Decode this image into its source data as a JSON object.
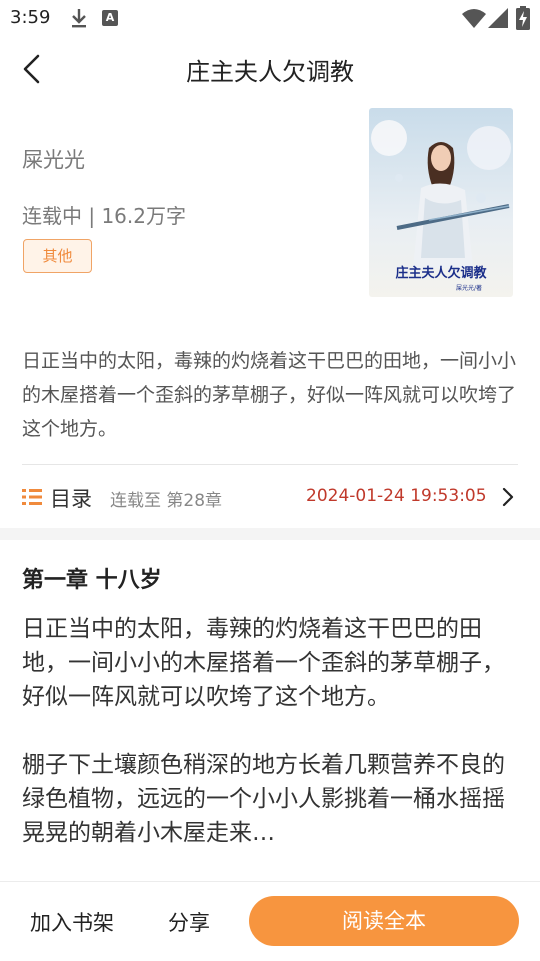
{
  "status_bar": {
    "time": "3:59",
    "a_icon_glyph": "A"
  },
  "header": {
    "title": "庄主夫人欠调教"
  },
  "book": {
    "author": "屎光光",
    "status": "连载中 | 16.2万字",
    "tag": "其他",
    "cover_title": "庄主夫人欠调教",
    "cover_author": "屎光光/著",
    "intro": "日正当中的太阳，毒辣的灼烧着这干巴巴的田地，一间小小的木屋搭着一个歪斜的茅草棚子，好似一阵风就可以吹垮了这个地方。"
  },
  "toc": {
    "label": "目录",
    "status": "连载至 第28章",
    "updated": "2024-01-24 19:53:05"
  },
  "chapter": {
    "title": "第一章 十八岁",
    "p1": "日正当中的太阳，毒辣的灼烧着这干巴巴的田地，一间小小的木屋搭着一个歪斜的茅草棚子，好似一阵风就可以吹垮了这个地方。",
    "p2": "棚子下土壤颜色稍深的地方长着几颗营养不良的绿色植物，远远的一个小小人影挑着一桶水摇摇晃晃的朝着小木屋走来…"
  },
  "bottom": {
    "shelf_label": "加入书架",
    "share_label": "分享",
    "read_label": "阅读全本"
  },
  "colors": {
    "accent": "#f7953f",
    "date": "#c0392b",
    "tag_border": "#f0a466"
  }
}
